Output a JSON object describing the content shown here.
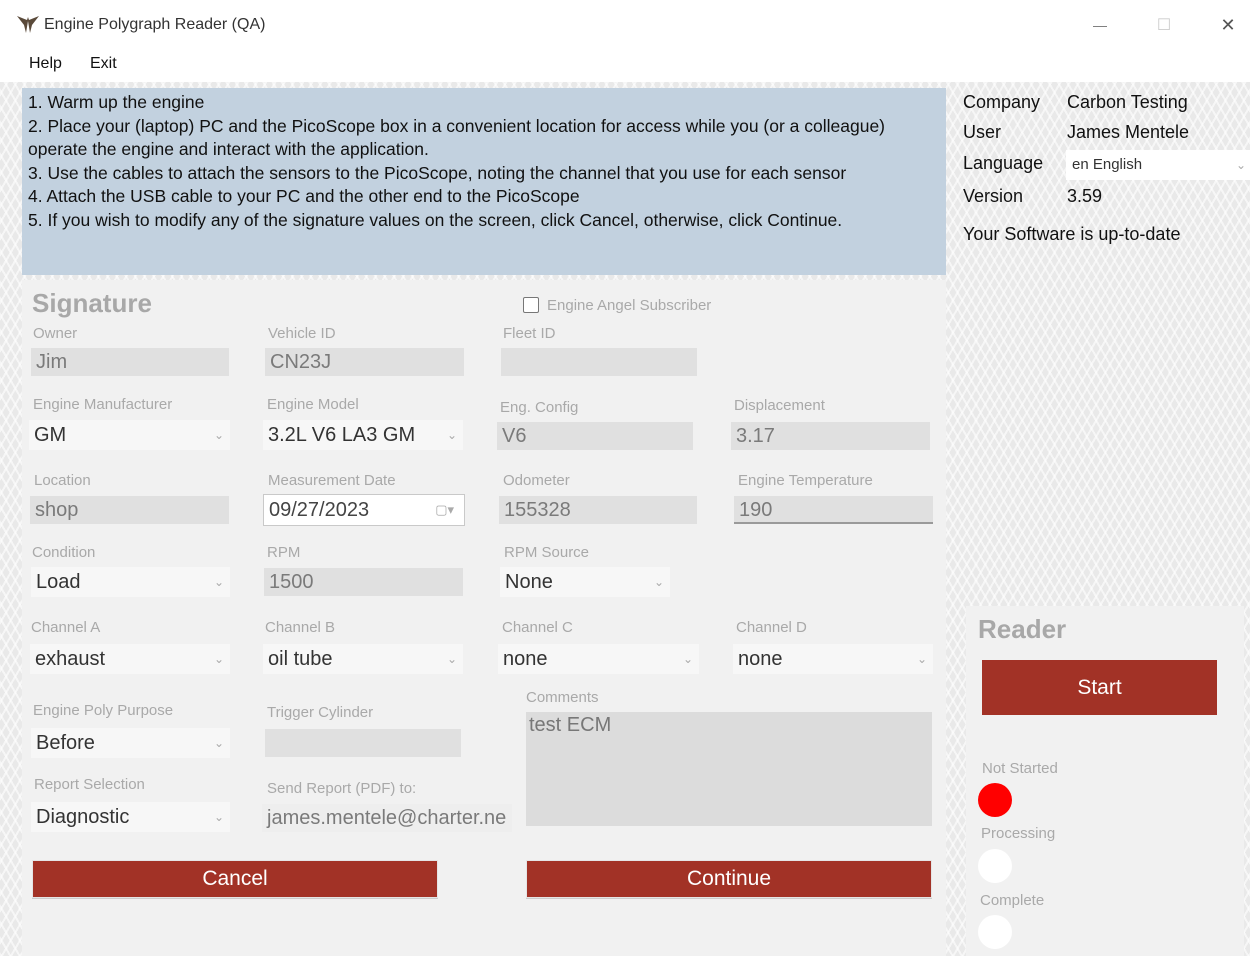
{
  "window": {
    "title": "Engine Polygraph Reader (QA)",
    "minimize_glyph": "—",
    "maximize_glyph": "☐",
    "close_glyph": "✕"
  },
  "menu": [
    {
      "label": "Help"
    },
    {
      "label": "Exit"
    }
  ],
  "instructions": [
    "1. Warm up the engine",
    "2. Place your (laptop) PC and the PicoScope box in a convenient location for access while you (or a colleague) operate the engine and interact with the application.",
    "3. Use the cables to attach the sensors to the PicoScope, noting the channel that you use for each sensor",
    "4. Attach the USB cable to your PC and the other end to the PicoScope",
    "5. If you wish to modify any of the signature values on the screen, click Cancel, otherwise, click Continue."
  ],
  "info": {
    "company_label": "Company",
    "company": "Carbon Testing",
    "user_label": "User",
    "user": "James Mentele",
    "language_label": "Language",
    "language": "en English",
    "version_label": "Version",
    "version": "3.59",
    "update_status": "Your Software is up-to-date"
  },
  "signature": {
    "title": "Signature",
    "subscriber_label": "Engine Angel Subscriber",
    "subscriber_checked": false,
    "owner_label": "Owner",
    "owner": "Jim",
    "vehicle_id_label": "Vehicle ID",
    "vehicle_id": "CN23J",
    "fleet_id_label": "Fleet ID",
    "fleet_id": "",
    "engine_manufacturer_label": "Engine Manufacturer",
    "engine_manufacturer": "GM",
    "engine_model_label": "Engine Model",
    "engine_model": "3.2L V6 LA3 GM",
    "eng_config_label": "Eng. Config",
    "eng_config": "V6",
    "displacement_label": "Displacement",
    "displacement": "3.17",
    "location_label": "Location",
    "location": "shop",
    "measurement_date_label": "Measurement Date",
    "measurement_date": "09/27/2023",
    "odometer_label": "Odometer",
    "odometer": "155328",
    "engine_temperature_label": "Engine Temperature",
    "engine_temperature": "190",
    "condition_label": "Condition",
    "condition": "Load",
    "rpm_label": "RPM",
    "rpm": "1500",
    "rpm_source_label": "RPM Source",
    "rpm_source": "None",
    "channel_a_label": "Channel A",
    "channel_a": "exhaust",
    "channel_b_label": "Channel B",
    "channel_b": "oil tube",
    "channel_c_label": "Channel C",
    "channel_c": "none",
    "channel_d_label": "Channel D",
    "channel_d": "none",
    "purpose_label": "Engine Poly Purpose",
    "purpose": "Before",
    "trigger_cylinder_label": "Trigger Cylinder",
    "trigger_cylinder": "",
    "comments_label": "Comments",
    "comments": "test ECM",
    "report_selection_label": "Report Selection",
    "report_selection": "Diagnostic",
    "send_report_label": "Send Report (PDF) to:",
    "send_report": "james.mentele@charter.ne",
    "cancel_label": "Cancel",
    "continue_label": "Continue"
  },
  "reader": {
    "title": "Reader",
    "start_label": "Start",
    "statuses": [
      {
        "label": "Not Started",
        "color": "#ff0000"
      },
      {
        "label": "Processing",
        "color": "#ffffff"
      },
      {
        "label": "Complete",
        "color": "#ffffff"
      }
    ]
  },
  "colors": {
    "accent_button": "#a23226",
    "instruction_bg": "#c2d1df"
  }
}
